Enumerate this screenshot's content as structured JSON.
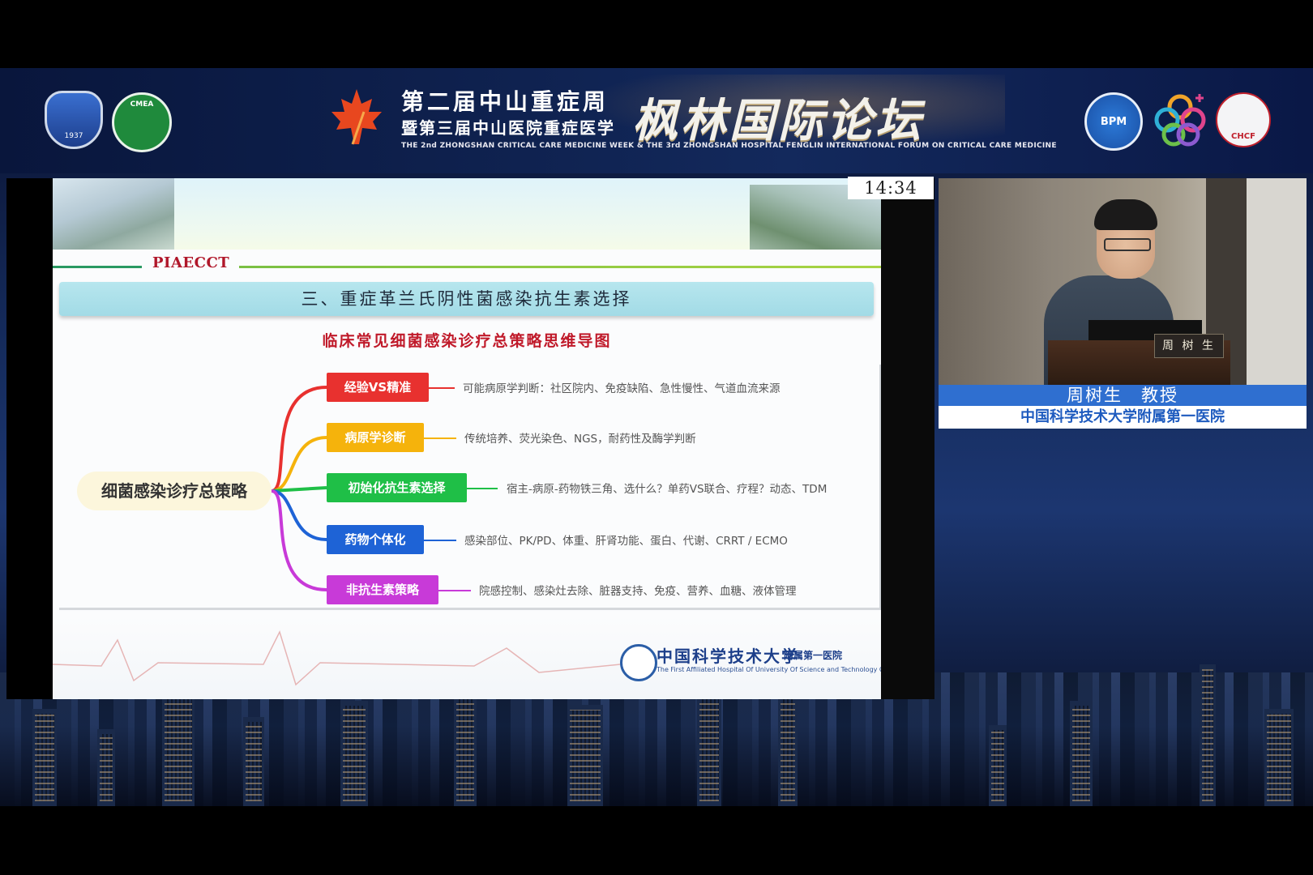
{
  "banner": {
    "title_line1": "第二届中山重症周",
    "title_line2": "暨第三届中山医院重症医学",
    "title_big": "枫林国际论坛",
    "subtitle": "THE 2nd ZHONGSHAN CRITICAL CARE MEDICINE WEEK & THE 3rd ZHONGSHAN HOSPITAL FENGLIN INTERNATIONAL FORUM ON CRITICAL CARE MEDICINE",
    "logos": {
      "left1": "1937",
      "left2": "CMEA",
      "right1": "BPM",
      "right3": "CHCF"
    }
  },
  "clock": "14:34",
  "slide": {
    "tag": "PIAECCT",
    "section_title": "三、重症革兰氏阴性菌感染抗生素选择",
    "map_title": "临床常见细菌感染诊疗总策略思维导图",
    "root": "细菌感染诊疗总策略",
    "branches": [
      {
        "label": "经验VS精准",
        "color": "#e8312f",
        "desc": "可能病原学判断：社区院内、免疫缺陷、急性慢性、气道血流来源"
      },
      {
        "label": "病原学诊断",
        "color": "#f5b30c",
        "desc": "传统培养、荧光染色、NGS，耐药性及酶学判断"
      },
      {
        "label": "初始化抗生素选择",
        "color": "#1fbf47",
        "desc": "宿主-病原-药物铁三角、选什么？单药VS联合、疗程？动态、TDM"
      },
      {
        "label": "药物个体化",
        "color": "#1e63d6",
        "desc": "感染部位、PK/PD、体重、肝肾功能、蛋白、代谢、CRRT / ECMO"
      },
      {
        "label": "非抗生素策略",
        "color": "#c83ad8",
        "desc": "院感控制、感染灶去除、脏器支持、免疫、营养、血糖、液体管理"
      }
    ],
    "footer_cn": "中国科学技术大学",
    "footer_cn_small": "附属第一医院",
    "footer_en": "The First Affiliated Hospital Of University Of Science and Technology Of China"
  },
  "speaker": {
    "nameplate": "周 树 生",
    "name_title": "周树生　教授",
    "affiliation": "中国科学技术大学附属第一医院"
  }
}
